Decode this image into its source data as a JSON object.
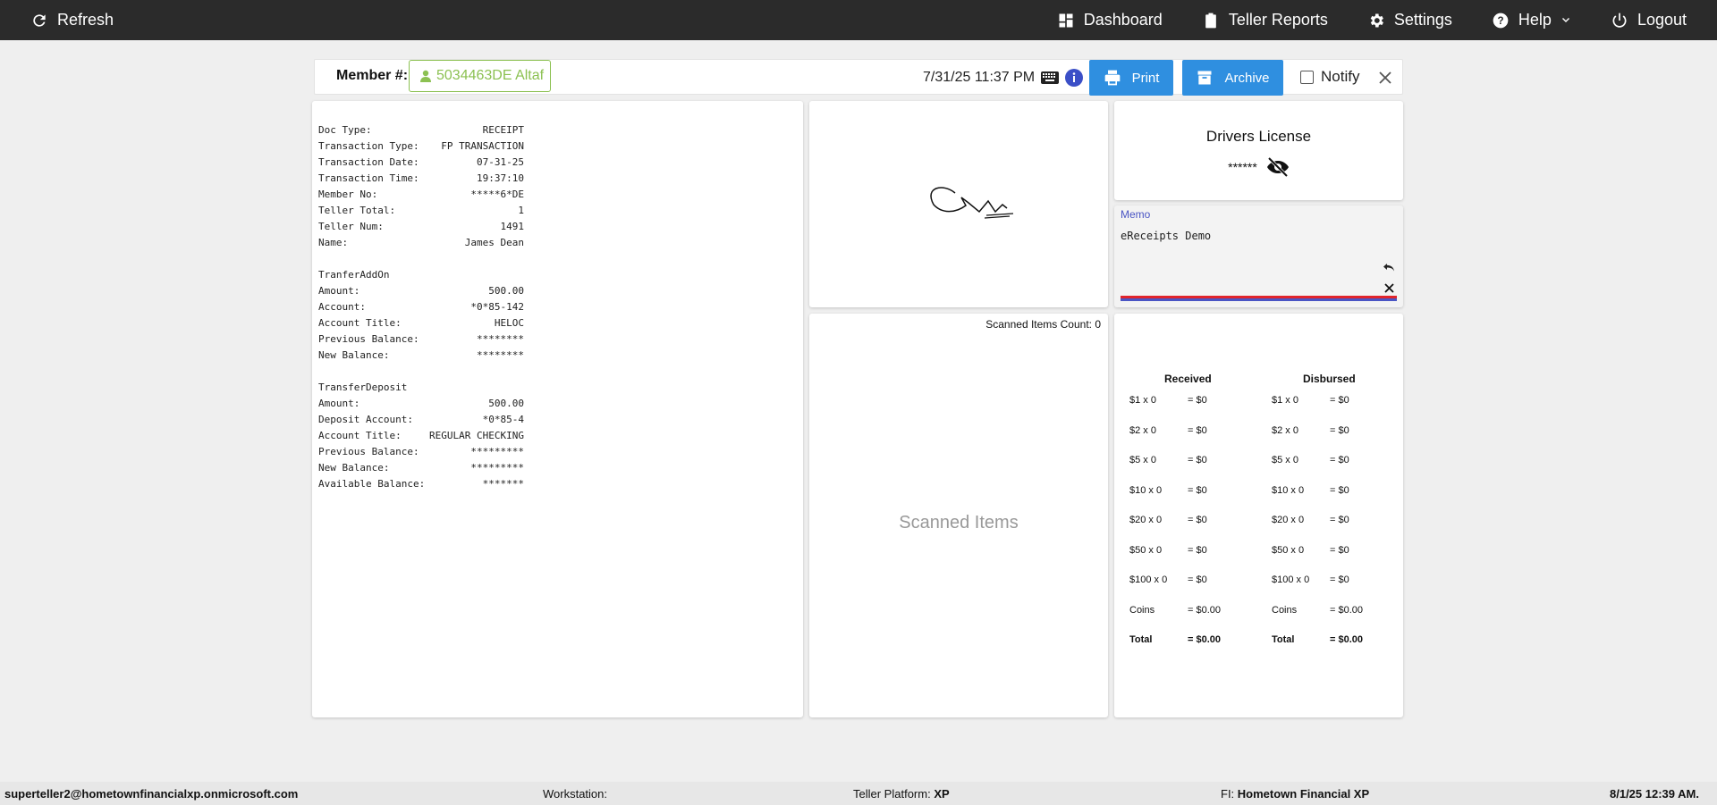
{
  "navbar": {
    "refresh": "Refresh",
    "dashboard": "Dashboard",
    "teller_reports": "Teller Reports",
    "settings": "Settings",
    "help": "Help",
    "logout": "Logout"
  },
  "member_bar": {
    "label": "Member #:",
    "member": "5034463DE Altaf",
    "datetime": "7/31/25 11:37 PM",
    "print": "Print",
    "archive": "Archive",
    "notify": "Notify"
  },
  "receipt": {
    "rows": [
      [
        "Doc Type:",
        "RECEIPT"
      ],
      [
        "Transaction Type:",
        "FP TRANSACTION"
      ],
      [
        "Transaction Date:",
        "07-31-25"
      ],
      [
        "Transaction Time:",
        "19:37:10"
      ],
      [
        "Member No:",
        "*****6*DE"
      ],
      [
        "Teller Total:",
        "1"
      ],
      [
        "Teller Num:",
        "1491"
      ],
      [
        "Name:",
        "James Dean"
      ],
      [
        "",
        ""
      ],
      [
        "TranferAddOn",
        ""
      ],
      [
        "Amount:",
        "500.00"
      ],
      [
        "Account:",
        "*0*85-142"
      ],
      [
        "Account Title:",
        "HELOC"
      ],
      [
        "Previous Balance:",
        "********"
      ],
      [
        "New Balance:",
        "********"
      ],
      [
        "",
        ""
      ],
      [
        "TransferDeposit",
        ""
      ],
      [
        "Amount:",
        "500.00"
      ],
      [
        "Deposit Account:",
        "*0*85-4"
      ],
      [
        "Account Title:",
        "REGULAR CHECKING"
      ],
      [
        "Previous Balance:",
        "*********"
      ],
      [
        "New Balance:",
        "*********"
      ],
      [
        "Available Balance:",
        "*******"
      ]
    ]
  },
  "drivers_license": {
    "title": "Drivers License",
    "value": "******"
  },
  "memo": {
    "label": "Memo",
    "text": "eReceipts Demo"
  },
  "scanned": {
    "count_label": "Scanned Items Count: 0",
    "placeholder": "Scanned Items"
  },
  "cash": {
    "received_title": "Received",
    "disbursed_title": "Disbursed",
    "received": [
      [
        "$1 x 0",
        "= $0"
      ],
      [
        "$2 x 0",
        "= $0"
      ],
      [
        "$5 x 0",
        "= $0"
      ],
      [
        "$10 x 0",
        "= $0"
      ],
      [
        "$20 x 0",
        "= $0"
      ],
      [
        "$50 x 0",
        "= $0"
      ],
      [
        "$100 x 0",
        "= $0"
      ],
      [
        "Coins",
        "= $0.00"
      ],
      [
        "Total",
        "= $0.00"
      ]
    ],
    "disbursed": [
      [
        "$1 x 0",
        "= $0"
      ],
      [
        "$2 x 0",
        "= $0"
      ],
      [
        "$5 x 0",
        "= $0"
      ],
      [
        "$10 x 0",
        "= $0"
      ],
      [
        "$20 x 0",
        "= $0"
      ],
      [
        "$50 x 0",
        "= $0"
      ],
      [
        "$100 x 0",
        "= $0"
      ],
      [
        "Coins",
        "= $0.00"
      ],
      [
        "Total",
        "= $0.00"
      ]
    ]
  },
  "footer": {
    "user": "superteller2@hometownfinancialxp.onmicrosoft.com",
    "workstation_label": "Workstation:",
    "platform_label": "Teller Platform:",
    "platform_value": "XP",
    "fi_label": "FI:",
    "fi_value": "Hometown Financial XP",
    "datetime": "8/1/25 12:39 AM."
  }
}
